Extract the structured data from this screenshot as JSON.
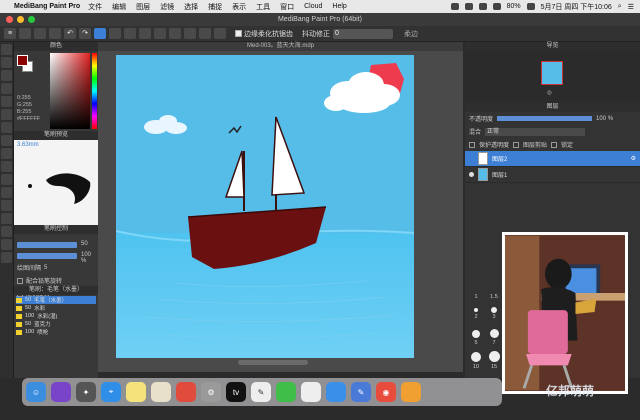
{
  "menubar": {
    "app_name": "MediBang Paint Pro",
    "items": [
      "文件",
      "编辑",
      "图层",
      "滤镜",
      "选择",
      "捕捉",
      "表示",
      "工具",
      "窗口",
      "Cloud",
      "Help"
    ],
    "battery": "80%",
    "clock": "5月7日 周四 下午10:06"
  },
  "window": {
    "title": "MediBang Paint Pro (64bit)",
    "doc_tab": "Med-003。蓝天大海.mdp"
  },
  "toolbar": {
    "antialias_label": "边缘柔化抗锯齿",
    "correction_label": "抖动修正",
    "correction_value": "0",
    "softness_label": "柔边"
  },
  "panels": {
    "color_title": "颜色",
    "color_values": [
      "0:255",
      "G:255",
      "B:255",
      "#FFFFFF"
    ],
    "brush_preview_title": "笔刷预览",
    "brush_size": "3.63mm",
    "brush_control_title": "笔刷控制",
    "size_value": "50",
    "opacity_value": "100 %",
    "stabilizer_label": "绘图间隔",
    "stabilizer_value": "5",
    "rotate_label": "配合铅笔旋转",
    "random_label": "随机旋转",
    "brush_list_title": "笔刷：毛笔（水墨）",
    "brushes": [
      {
        "size": "50",
        "name": "毛笔（水墨）"
      },
      {
        "size": "50",
        "name": "水彩"
      },
      {
        "size": "100",
        "name": "水彩(湿)"
      },
      {
        "size": "50",
        "name": "蓝克力"
      },
      {
        "size": "100",
        "name": "喷枪"
      }
    ]
  },
  "right": {
    "navigator_title": "导览",
    "layer_title": "图层",
    "opacity_label": "不透明度",
    "opacity_value": "100 %",
    "blend_label": "混合",
    "blend_value": "正常",
    "protect_label": "保护透明度",
    "clip_label": "图层剪贴",
    "lock_label": "锁定",
    "layers": [
      {
        "name": "图层2",
        "selected": true
      },
      {
        "name": "图层1",
        "selected": false
      }
    ],
    "brush_sizes": [
      "1",
      "1.5",
      "2",
      "3",
      "5",
      "7",
      "10",
      "15",
      "20",
      "30",
      "50",
      "70",
      "100",
      "150",
      "200"
    ]
  },
  "watermark": "亿邦萌萌",
  "colors": {
    "sky": "#56bde8",
    "sea": "#4fc3f0",
    "hull": "#6b1010",
    "accent": "#3d7fd4"
  }
}
